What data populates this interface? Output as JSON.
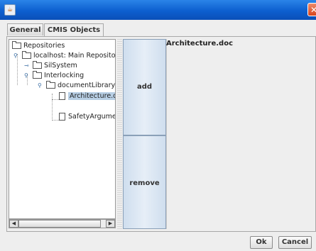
{
  "window": {
    "close_glyph": "✕",
    "icon": "java-cup-icon"
  },
  "tabs": [
    {
      "label": "General"
    },
    {
      "label": "CMIS Objects"
    }
  ],
  "tree": {
    "root": "Repositories",
    "repo": "localhost: Main Repository",
    "folders": [
      "SilSystem",
      "Interlocking"
    ],
    "library": "documentLibrary",
    "documents": [
      "Architecture.doc",
      "SafetyArgument"
    ]
  },
  "actions": {
    "add": "add",
    "remove": "remove"
  },
  "content": {
    "title": "Architecture.doc"
  },
  "footer": {
    "ok": "Ok",
    "cancel": "Cancel"
  }
}
